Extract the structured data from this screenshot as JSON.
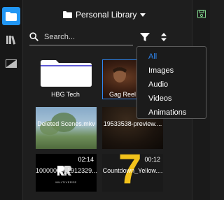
{
  "header": {
    "library_name": "Personal Library"
  },
  "search": {
    "placeholder": "Search..."
  },
  "filter_menu": {
    "items": [
      {
        "label": "All",
        "selected": true
      },
      {
        "label": "Images",
        "selected": false
      },
      {
        "label": "Audio",
        "selected": false
      },
      {
        "label": "Videos",
        "selected": false
      },
      {
        "label": "Animations",
        "selected": false
      }
    ]
  },
  "media": [
    {
      "name": "HBG Tech",
      "kind": "folder"
    },
    {
      "name": "Gag Reel G",
      "kind": "video"
    },
    {
      "name": "Deleted Scenes.mkv",
      "kind": "video"
    },
    {
      "name": "19533538-preview....",
      "kind": "video"
    },
    {
      "name": "10000000_1912329...",
      "kind": "video",
      "duration": "02:14",
      "logo_text": "MULTIVERSE"
    },
    {
      "name": "Countdown_Yellow....",
      "kind": "video",
      "duration": "00:12",
      "digit": "7"
    }
  ],
  "colors": {
    "accent": "#2196f3",
    "selected_text": "#2f86f0",
    "countdown_yellow": "#f2c21b"
  },
  "icons": {
    "rail": [
      "folder-icon",
      "library-icon",
      "transition-icon"
    ],
    "right_rail": [
      "save-icon"
    ]
  }
}
